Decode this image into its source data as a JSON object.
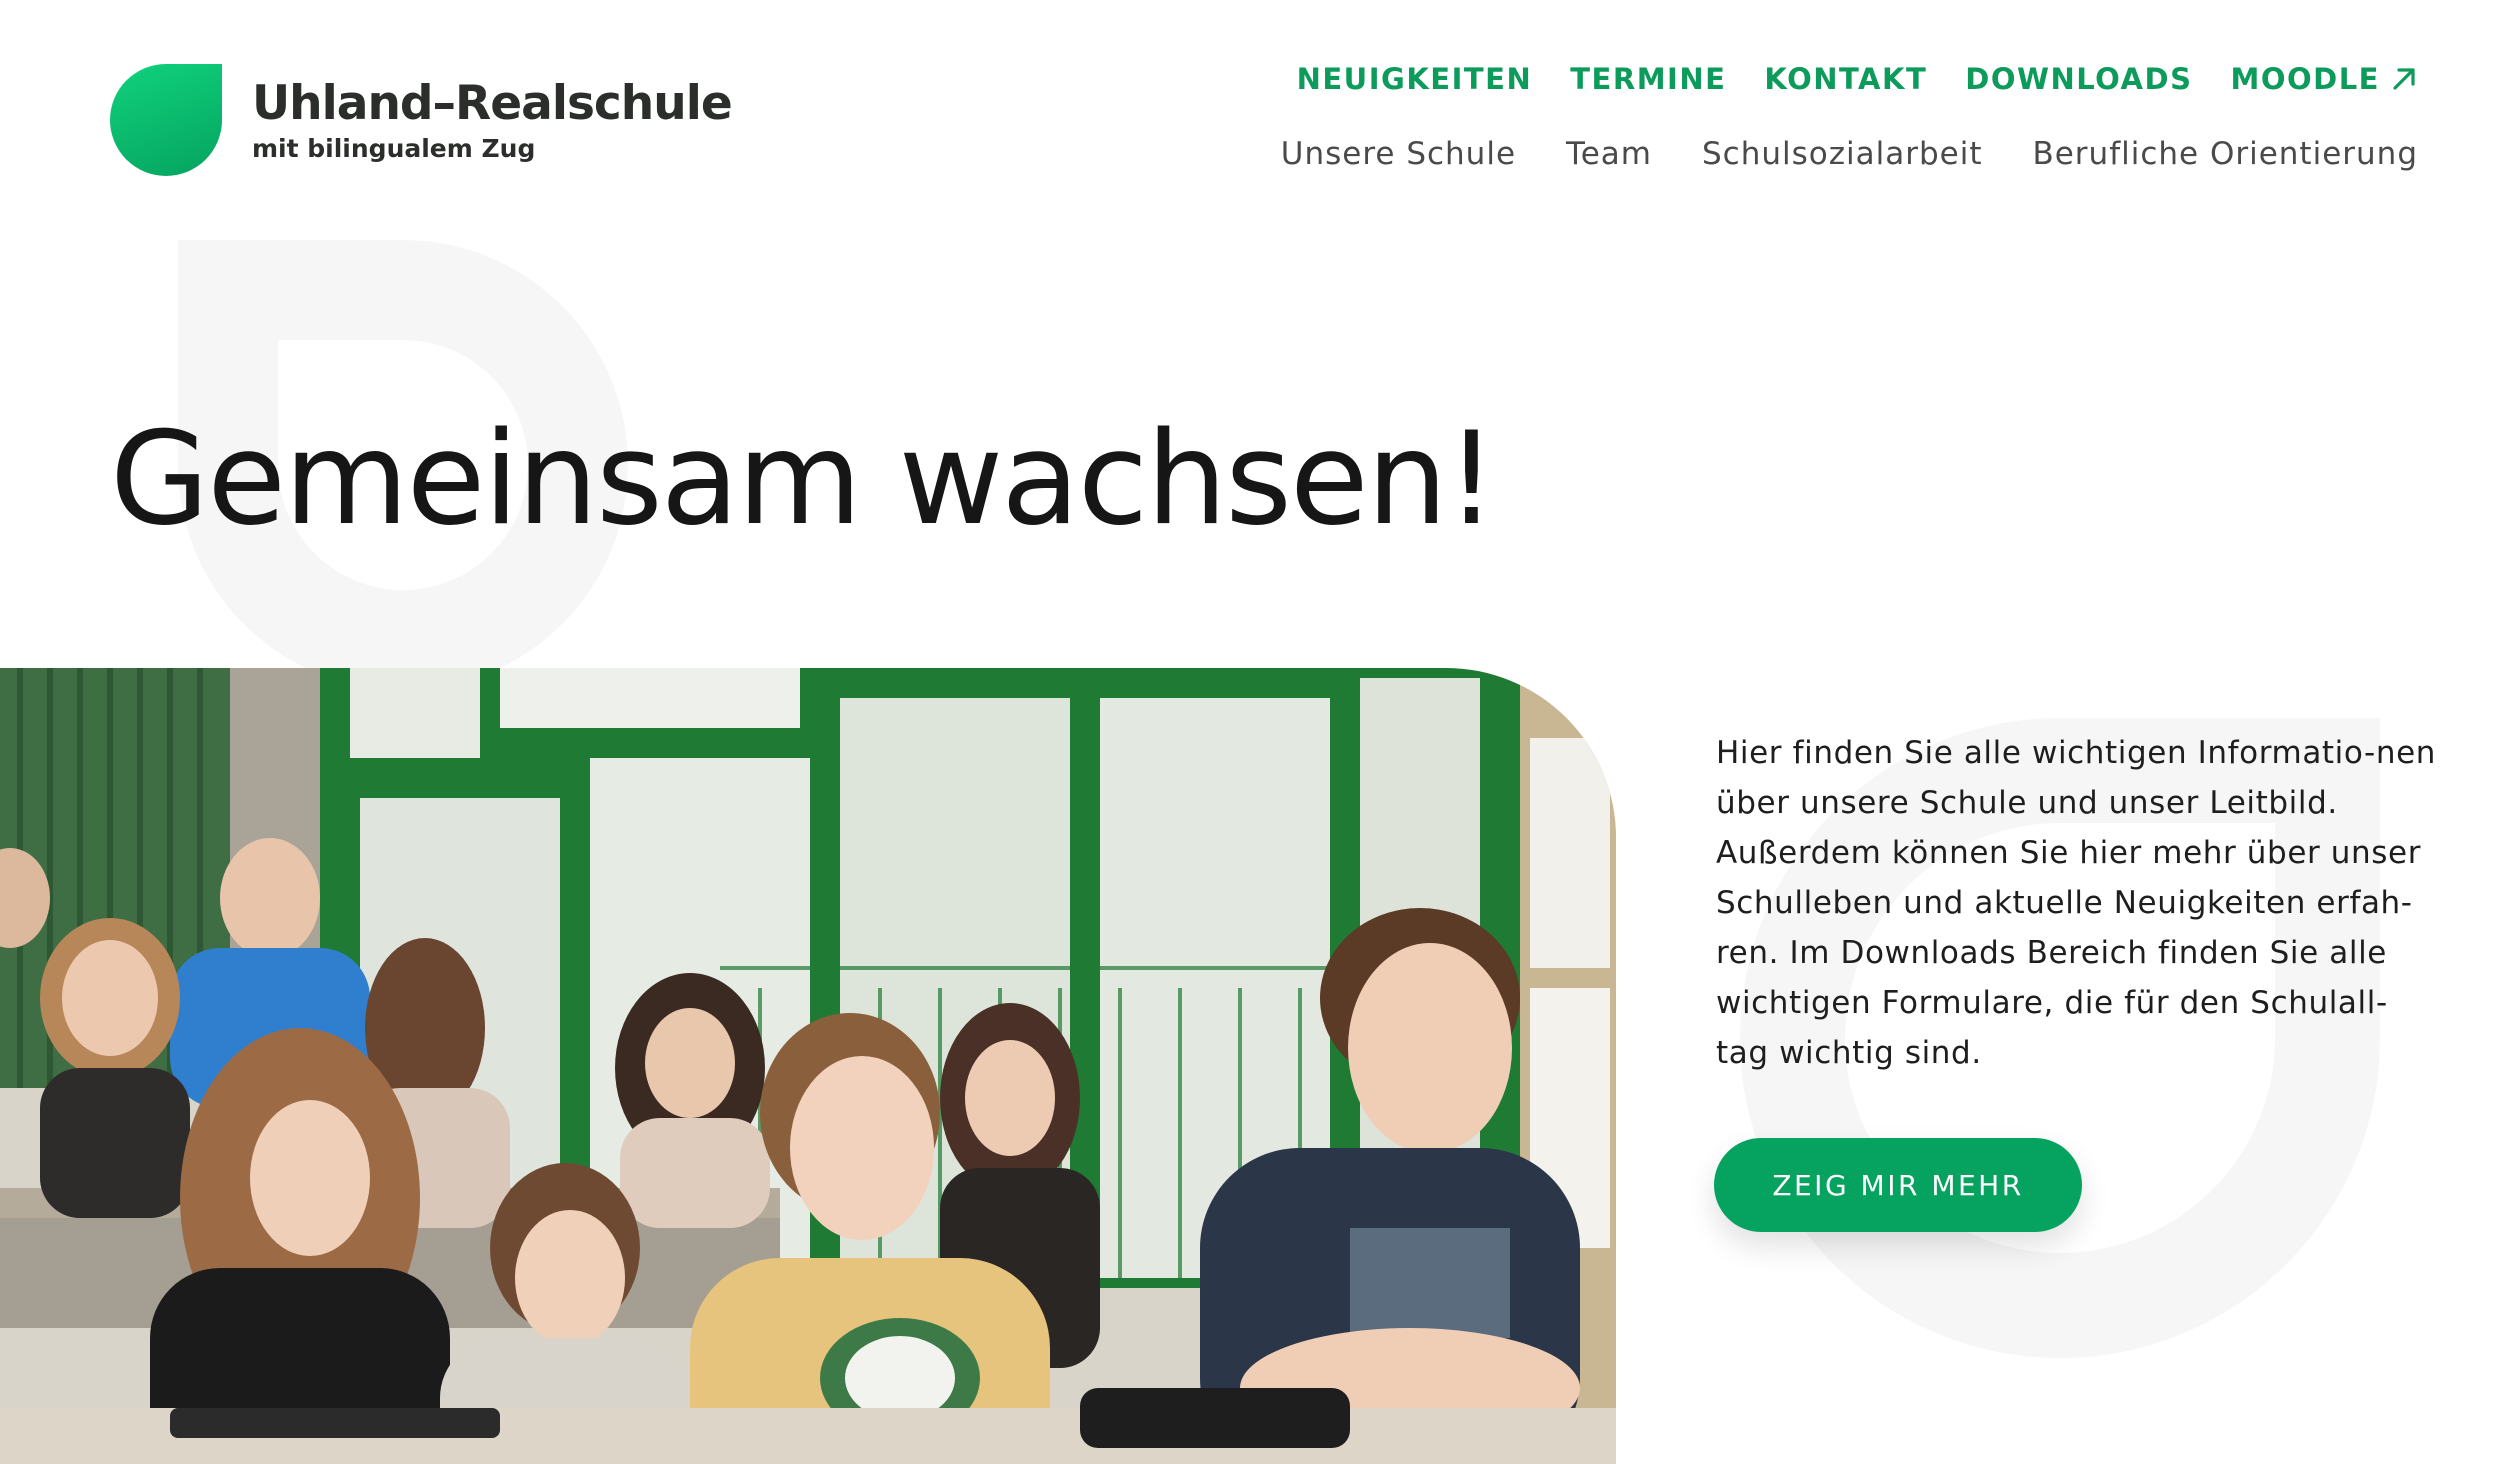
{
  "brand": {
    "title": "Uhland–Realschule",
    "subtitle": "mit bilingualem Zug",
    "accent_color": "#05a35f",
    "text_color": "#2b2e2b"
  },
  "nav": {
    "primary": [
      {
        "label": "NEUIGKEITEN"
      },
      {
        "label": "TERMINE"
      },
      {
        "label": "KONTAKT"
      },
      {
        "label": "DOWNLOADS"
      },
      {
        "label": "MOODLE",
        "icon": "external-arrow-icon"
      }
    ],
    "secondary": [
      {
        "label": "Unsere Schule"
      },
      {
        "label": "Team"
      },
      {
        "label": "Schulsozialarbeit"
      },
      {
        "label": "Berufliche Orientierung"
      }
    ]
  },
  "hero": {
    "heading": "Gemeinsam wachsen!",
    "photo_subject": "classroom-students-photo",
    "intro": "Hier finden Sie alle wichtigen Informatio-nen über unsere Schule und unser Leitbild. Außerdem können Sie hier mehr über unser Schulleben und aktuelle Neuigkeiten erfah-ren. Im Downloads Bereich finden Sie alle wichtigen Formulare, die für den Schulall-tag wichtig sind.",
    "cta_label": "ZEIG MIR MEHR"
  }
}
